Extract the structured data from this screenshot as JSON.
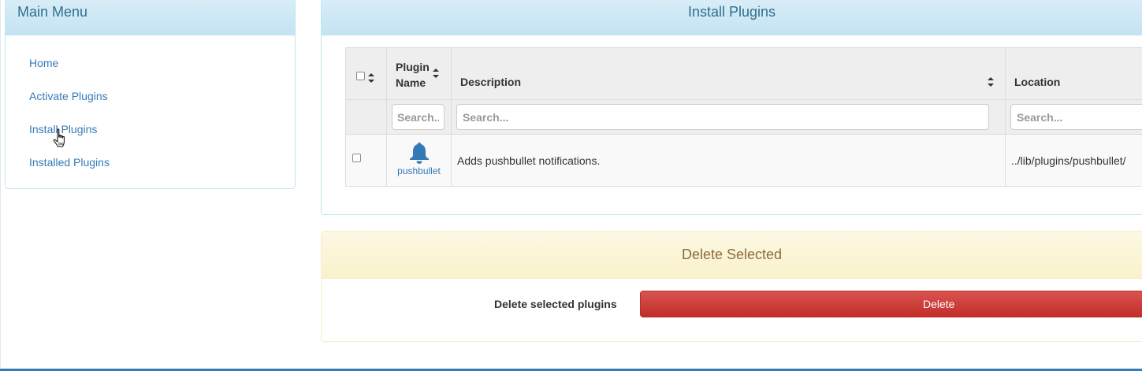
{
  "main_menu": {
    "title": "Main Menu",
    "items": [
      {
        "label": "Home"
      },
      {
        "label": "Activate Plugins"
      },
      {
        "label": "Install Plugins"
      },
      {
        "label": "Installed Plugins"
      }
    ]
  },
  "install_panel": {
    "title": "Install Plugins",
    "table": {
      "columns": {
        "plugin_name_line1": "Plugin",
        "plugin_name_line2": "Name",
        "description": "Description",
        "location": "Location"
      },
      "search_placeholders": {
        "plugin_name": "Search...",
        "description": "Search...",
        "location": "Search..."
      },
      "rows": [
        {
          "icon": "bell-icon",
          "name": "pushbullet",
          "description": "Adds pushbullet notifications.",
          "location": "../lib/plugins/pushbullet/"
        }
      ]
    }
  },
  "delete_panel": {
    "title": "Delete Selected",
    "label": "Delete selected plugins",
    "button_label": "Delete"
  },
  "colors": {
    "link": "#337ab7",
    "info_heading": "#31708f",
    "warning_heading": "#8a6d3b",
    "danger_button": "#d9534f"
  }
}
